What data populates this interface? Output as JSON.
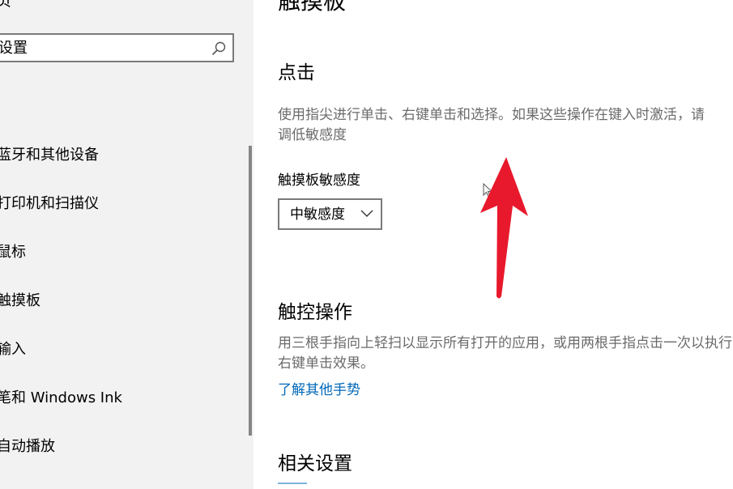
{
  "sidebar": {
    "top_label": "页",
    "search": {
      "value": "设置"
    },
    "items": [
      {
        "label": "蓝牙和其他设备"
      },
      {
        "label": "打印机和扫描仪"
      },
      {
        "label": "鼠标"
      },
      {
        "label": "触摸板"
      },
      {
        "label": "输入"
      },
      {
        "label": "笔和 Windows Ink"
      },
      {
        "label": "自动播放"
      }
    ]
  },
  "main": {
    "title": "触摸板",
    "tap_section": {
      "heading": "点击",
      "description": "使用指尖进行单击、右键单击和选择。如果这些操作在键入时激活，请调低敏感度",
      "sensitivity_label": "触摸板敏感度",
      "sensitivity_value": "中敏感度"
    },
    "gesture_section": {
      "heading": "触控操作",
      "description": "用三根手指向上轻扫以显示所有打开的应用，或用两根手指点击一次以执行右键单击效果。",
      "link": "了解其他手势"
    },
    "related_section": {
      "heading": "相关设置"
    }
  },
  "colors": {
    "sidebar_bg": "#f2f2f2",
    "link": "#0067b8",
    "annotation_arrow": "#e8192c",
    "description_text": "#6b6b6b"
  }
}
